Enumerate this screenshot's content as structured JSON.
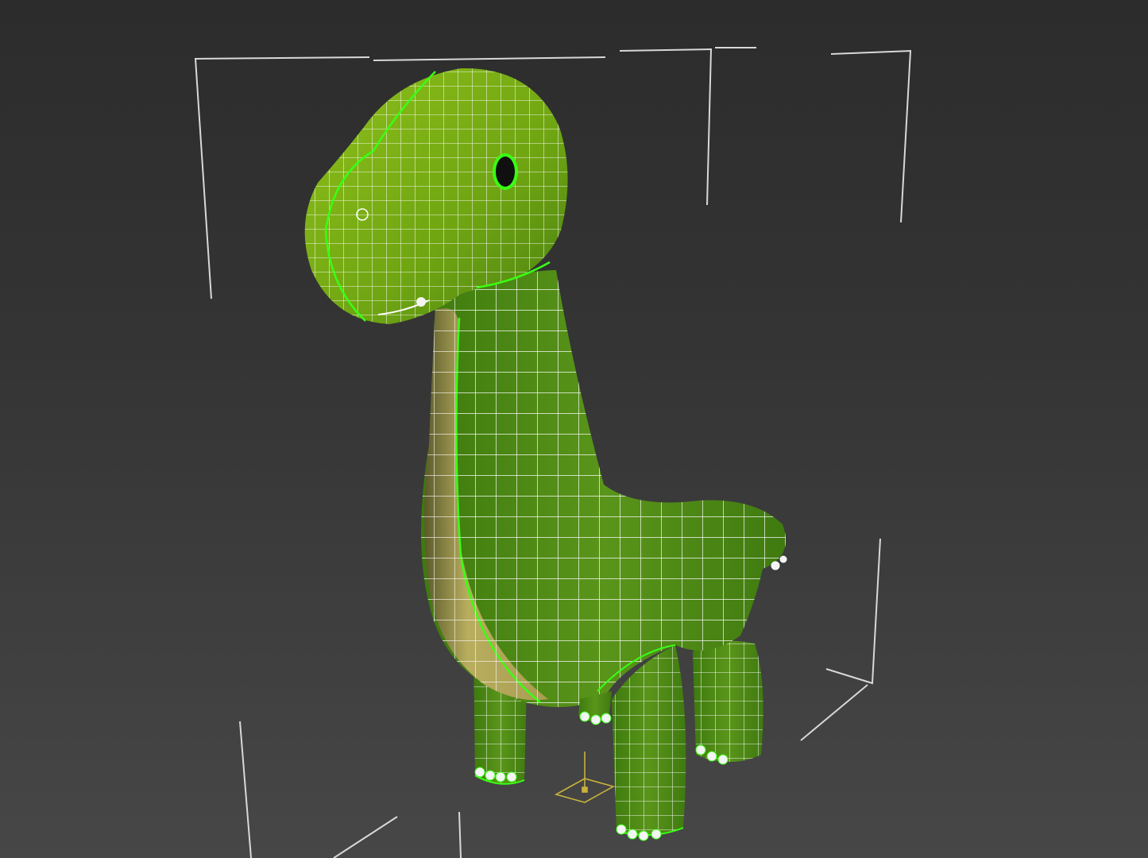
{
  "viewport": {
    "shading_mode": "edged faces",
    "background_top": "#2c2c2c",
    "background_bottom": "#474747"
  },
  "model": {
    "object": "dinosaur",
    "selection_state": "selected",
    "body_color": "#4f8a14",
    "head_color": "#7fb112",
    "belly_color": "#b4a95c",
    "wire_color": "#ffffff",
    "edge_highlight_color": "#39ff14"
  },
  "bounding_box": {
    "color": "#d8d8d8"
  },
  "pivot_gizmo": {
    "color": "#c9b23a"
  }
}
